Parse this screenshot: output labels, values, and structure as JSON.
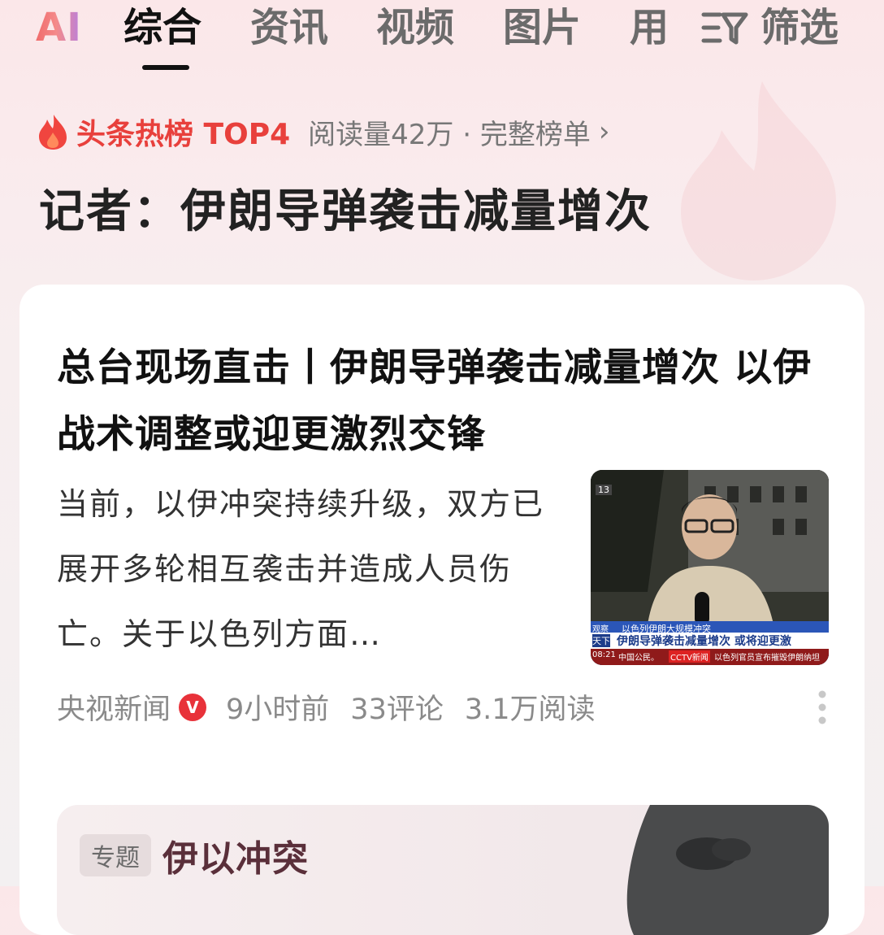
{
  "tabs": {
    "ai": "AI",
    "general": "综合",
    "news": "资讯",
    "video": "视频",
    "images": "图片",
    "use": "用",
    "filter": "筛选"
  },
  "hot": {
    "label": "头条热榜 TOP4",
    "meta": "阅读量42万 · 完整榜单",
    "chevron": "›",
    "title": "记者：伊朗导弹袭击减量增次"
  },
  "article": {
    "title": "总台现场直击丨伊朗导弹袭击减量增次 以伊战术调整或迎更激烈交锋",
    "summary": "当前，以伊冲突持续升级，双方已展开多轮相互袭击并造成人员伤亡。关于以色列方面…",
    "thumbnail": {
      "badge": "13",
      "ticker_top": "以色列伊朗大规模冲突",
      "ticker_label_left": "观察",
      "ticker_label_left2": "天下",
      "headline": "伊朗导弹袭击减量增次 或将迎更激",
      "time": "08:21",
      "bottom_left": "中国公民。",
      "channel": "CCTV新闻",
      "bottom_right": "以色列官员宣布摧毁伊朗纳坦"
    },
    "source": "央视新闻",
    "verified_mark": "V",
    "time_ago": "9小时前",
    "comments": "33评论",
    "reads": "3.1万阅读"
  },
  "topic": {
    "tag": "专题",
    "title": "伊以冲突"
  },
  "colors": {
    "hot_red": "#e8403c",
    "verified_red": "#e8323a",
    "active_tab": "#111111",
    "inactive_tab": "#6b6b6b"
  }
}
